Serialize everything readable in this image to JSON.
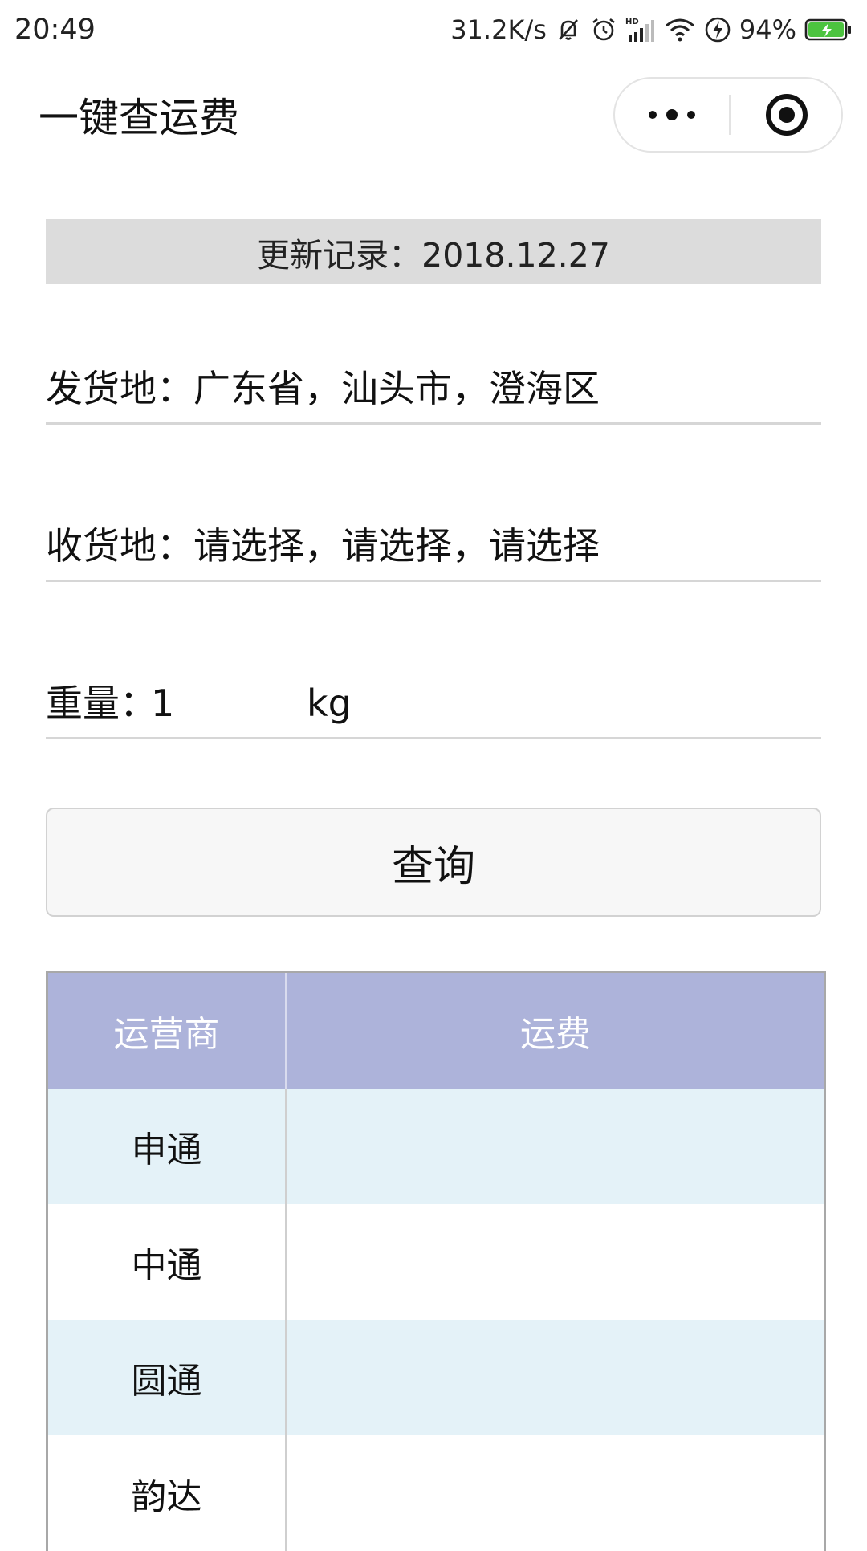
{
  "status_bar": {
    "time": "20:49",
    "speed": "31.2K/s",
    "battery": "94%",
    "icons": [
      "mute-bell-icon",
      "alarm-icon",
      "hd-signal-icon",
      "wifi-icon",
      "charging-icon",
      "battery-icon"
    ]
  },
  "nav": {
    "title": "一键查运费",
    "more_icon": "more-dots-icon",
    "close_icon": "target-circle-icon"
  },
  "update": {
    "text": "更新记录：2018.12.27"
  },
  "form": {
    "origin": "发货地：广东省，汕头市，澄海区",
    "destination": "收货地：请选择，请选择，请选择",
    "weight_label": "重量：",
    "weight_value": "1",
    "weight_unit": "kg"
  },
  "query_button": "查询",
  "table": {
    "headers": [
      "运营商",
      "运费"
    ],
    "rows": [
      {
        "carrier": "申通",
        "fee": ""
      },
      {
        "carrier": "中通",
        "fee": ""
      },
      {
        "carrier": "圆通",
        "fee": ""
      },
      {
        "carrier": "韵达",
        "fee": ""
      }
    ]
  },
  "colors": {
    "header_bg": "#adb3da",
    "alt_row_bg": "#e4f2f8",
    "update_bar_bg": "#dcdcdc"
  }
}
